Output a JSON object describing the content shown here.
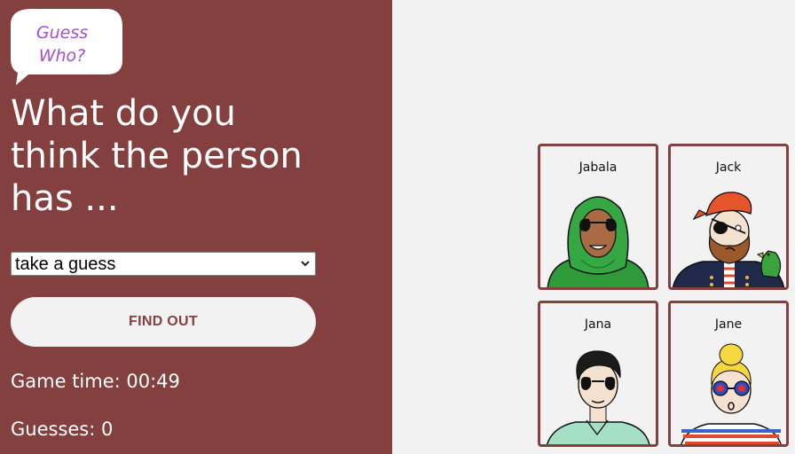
{
  "logo": {
    "line1": "Guess",
    "line2": "Who?"
  },
  "question": {
    "line1": "What do you",
    "line2": "think the person",
    "line3": "has ..."
  },
  "guess_select": {
    "selected": "take a guess",
    "icon": "chevron-down-icon"
  },
  "find_out_button": {
    "label": "FIND OUT"
  },
  "stats": {
    "game_time": "Game time: 00:49",
    "guesses": "Guesses: 0"
  },
  "characters": [
    {
      "name": "Jabala"
    },
    {
      "name": "Jack"
    },
    {
      "name": "Jana"
    },
    {
      "name": "Jane"
    }
  ],
  "colors": {
    "accent": "#843f3f",
    "background": "#f2f2f2",
    "logo_text": "#a64dd9"
  }
}
